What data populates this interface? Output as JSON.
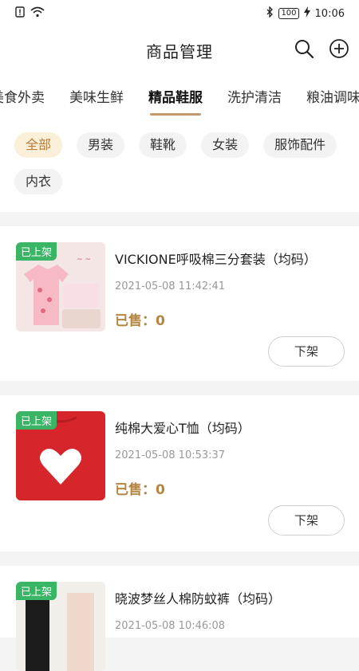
{
  "status": {
    "battery": "100",
    "time": "10:06"
  },
  "header": {
    "title": "商品管理"
  },
  "tabs": [
    "美食外卖",
    "美味生鲜",
    "精品鞋服",
    "洗护清洁",
    "粮油调味"
  ],
  "filters": [
    "全部",
    "男装",
    "鞋靴",
    "女装",
    "服饰配件",
    "内衣"
  ],
  "products": [
    {
      "badge": "已上架",
      "title": "VICKIONE呼吸棉三分套装（均码）",
      "date": "2021-05-08 11:42:41",
      "sold": "已售：0",
      "action": "下架"
    },
    {
      "badge": "已上架",
      "title": "纯棉大爱心T恤（均码）",
      "date": "2021-05-08 10:53:37",
      "sold": "已售：0",
      "action": "下架"
    },
    {
      "badge": "已上架",
      "title": "晓波梦丝人棉防蚊裤（均码）",
      "date": "2021-05-08 10:46:08",
      "sold": "",
      "action": ""
    }
  ],
  "colors": {
    "accent": "#c49a6c",
    "sold": "#b58541",
    "badge": "#3ab465",
    "chip_active_bg": "#faf0da"
  }
}
